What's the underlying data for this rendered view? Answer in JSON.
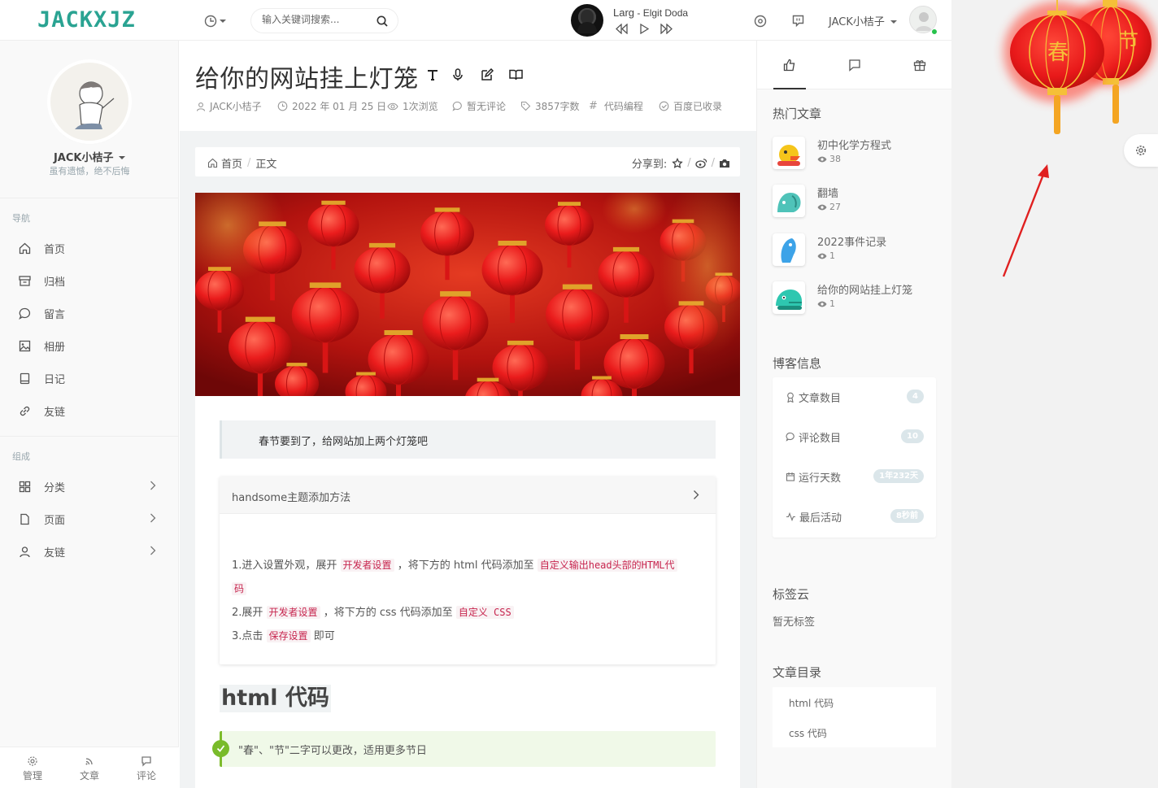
{
  "header": {
    "logo": "JACKXJZ",
    "search_placeholder": "输入关键词搜索...",
    "music": {
      "title": "Larg",
      "artist": "Elgit Doda",
      "separator": " - "
    },
    "user_name": "JACK小桔子"
  },
  "sidebar": {
    "profile_name": "JACK小桔子",
    "profile_bio": "虽有遗憾，绝不后悔",
    "nav_heading": "导航",
    "nav_items": [
      {
        "label": "首页",
        "icon": "home-icon"
      },
      {
        "label": "归档",
        "icon": "archive-icon"
      },
      {
        "label": "留言",
        "icon": "message-icon"
      },
      {
        "label": "相册",
        "icon": "image-icon"
      },
      {
        "label": "日记",
        "icon": "notebook-icon"
      },
      {
        "label": "友链",
        "icon": "link-icon"
      }
    ],
    "group_heading": "组成",
    "group_items": [
      {
        "label": "分类",
        "icon": "grid-icon"
      },
      {
        "label": "页面",
        "icon": "file-icon"
      },
      {
        "label": "友链",
        "icon": "user-icon"
      }
    ],
    "footer": [
      {
        "label": "管理",
        "icon": "gear-icon"
      },
      {
        "label": "文章",
        "icon": "rss-icon"
      },
      {
        "label": "评论",
        "icon": "comment-icon"
      }
    ]
  },
  "post": {
    "title": "给你的网站挂上灯笼",
    "meta": {
      "author": "JACK小桔子",
      "date": "2022 年 01 月 25 日",
      "views": "1次浏览",
      "comments": "暂无评论",
      "words": "3857字数",
      "category": "代码编程",
      "indexed": "百度已收录"
    },
    "breadcrumb": {
      "home": "首页",
      "current": "正文"
    },
    "share_label": "分享到:",
    "quote": "春节要到了，给网站加上两个灯笼吧",
    "collapse_title": "handsome主题添加方法",
    "steps": {
      "s1_a": "1.进入设置外观，展开",
      "s1_code1": "开发者设置",
      "s1_b": "，将下方的 html 代码添加至",
      "s1_code2": "自定义输出head头部的HTML代",
      "s1_code3": "码",
      "s2_a": "2.展开",
      "s2_code1": "开发者设置",
      "s2_b": "，将下方的 css 代码添加至",
      "s2_code2": "自定义 CSS",
      "s3_a": "3.点击",
      "s3_code1": "保存设置",
      "s3_b": "即可"
    },
    "h2": "html 代码",
    "tip": "\"春\"、\"节\"二字可以更改，适用更多节日"
  },
  "right": {
    "hot_title": "热门文章",
    "hot_items": [
      {
        "title": "初中化学方程式",
        "views": "38"
      },
      {
        "title": "翻墙",
        "views": "27"
      },
      {
        "title": "2022事件记录",
        "views": "1"
      },
      {
        "title": "给你的网站挂上灯笼",
        "views": "1"
      }
    ],
    "info_title": "博客信息",
    "info_items": [
      {
        "label": "文章数目",
        "value": "4"
      },
      {
        "label": "评论数目",
        "value": "10"
      },
      {
        "label": "运行天数",
        "value": "1年232天"
      },
      {
        "label": "最后活动",
        "value": "8秒前"
      }
    ],
    "tags_title": "标签云",
    "tags_empty": "暂无标签",
    "toc_title": "文章目录",
    "toc_items": [
      "html 代码",
      "css 代码"
    ]
  },
  "lanterns": [
    {
      "char": "春"
    },
    {
      "char": "节"
    }
  ],
  "colors": {
    "logo": "#2aa392",
    "lantern_red": "#e8191a",
    "lantern_gold": "#f5c038",
    "code_red": "#c7254e",
    "tip_green": "#79bb2a",
    "arrow_red": "#e02020"
  }
}
